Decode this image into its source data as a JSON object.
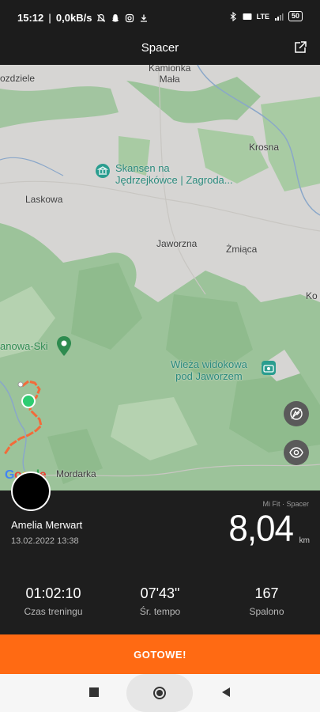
{
  "status": {
    "time": "15:12",
    "speed": "0,0kB/s",
    "network": "LTE",
    "battery": "50"
  },
  "header": {
    "title": "Spacer"
  },
  "map": {
    "labels": {
      "kamionka": "Kamionka\nMała",
      "ozdziele": "ozdziele",
      "krosna": "Krosna",
      "laskowa": "Laskowa",
      "jaworzna": "Jaworzna",
      "zmiaca": "Żmiąca",
      "ko": "Ko",
      "mordarka": "Mordarka"
    },
    "pois": {
      "skansen": "Skansen na\nJędrzejkówce | Zagroda...",
      "ski": "anowa-Ski",
      "wieza": "Wieża widokowa\npod Jaworzem"
    },
    "google": "Google",
    "colors": {
      "route": "#f26b3a",
      "start": "#2ecc71",
      "poi": "#2a8a7c"
    }
  },
  "workout": {
    "user_name": "Amelia Merwart",
    "date": "13.02.2022 13:38",
    "source": "Mi Fit · Spacer",
    "distance": "8,04",
    "distance_unit": "km",
    "metrics": [
      {
        "value": "01:02:10",
        "label": "Czas treningu"
      },
      {
        "value": "07'43\"",
        "label": "Śr. tempo"
      },
      {
        "value": "167",
        "label": "Spalono"
      }
    ]
  },
  "cta": {
    "label": "GOTOWE!"
  },
  "accent": "#ff6a13"
}
